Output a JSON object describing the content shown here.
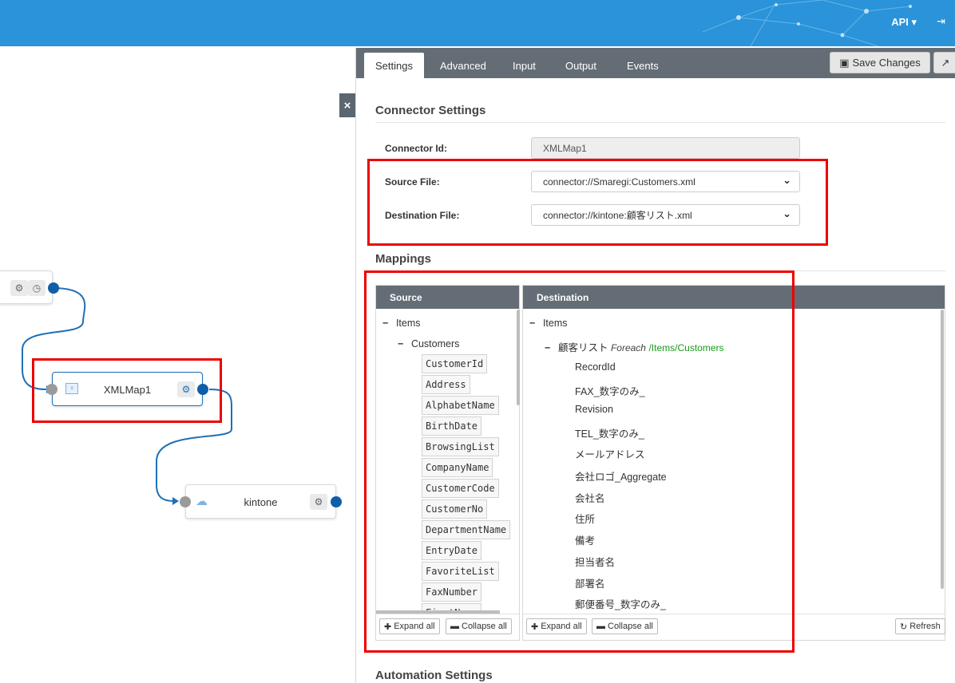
{
  "header": {
    "api_label": "API",
    "logout_icon": "logout-icon"
  },
  "canvas": {
    "nodes": [
      {
        "name": "XMLMap1",
        "icon": "xmlmap-icon"
      },
      {
        "name": "kintone",
        "icon": "cloud-icon"
      }
    ]
  },
  "tabs": [
    "Settings",
    "Advanced",
    "Input",
    "Output",
    "Events"
  ],
  "toolbar": {
    "save_label": "Save Changes"
  },
  "connector_settings": {
    "title": "Connector Settings",
    "connector_id_label": "Connector Id:",
    "connector_id_value": "XMLMap1",
    "source_file_label": "Source File:",
    "source_file_value": "connector://Smaregi:Customers.xml",
    "destination_file_label": "Destination File:",
    "destination_file_value": "connector://kintone:顧客リスト.xml"
  },
  "mappings": {
    "title": "Mappings",
    "source": {
      "header": "Source",
      "root": "Items",
      "group": "Customers",
      "fields": [
        "CustomerId",
        "Address",
        "AlphabetName",
        "BirthDate",
        "BrowsingList",
        "CompanyName",
        "CustomerCode",
        "CustomerNo",
        "DepartmentName",
        "EntryDate",
        "FavoriteList",
        "FaxNumber",
        "FirstName"
      ]
    },
    "destination": {
      "header": "Destination",
      "root": "Items",
      "group": "顧客リスト",
      "foreach_label": "Foreach",
      "foreach_path": "/Items/Customers",
      "fields": [
        "RecordId",
        "FAX_数字のみ_",
        "Revision",
        "TEL_数字のみ_",
        "メールアドレス",
        "会社ロゴ_Aggregate",
        "会社名",
        "住所",
        "備考",
        "担当者名",
        "部署名",
        "郵便番号_数字のみ_"
      ]
    },
    "expand_all": "Expand all",
    "collapse_all": "Collapse all",
    "refresh": "Refresh"
  },
  "automation_settings": {
    "title": "Automation Settings"
  },
  "colors": {
    "header_blue": "#2a93d9",
    "tab_bar": "#646d75",
    "port_blue": "#0e5ea8",
    "highlight_red": "#ee0000",
    "foreach_green": "#1a9a1a"
  }
}
